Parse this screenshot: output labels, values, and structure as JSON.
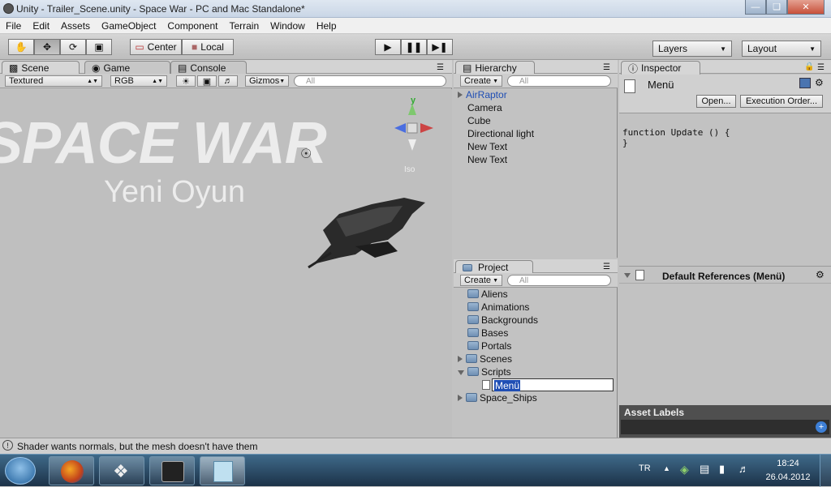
{
  "window": {
    "title": "Unity - Trailer_Scene.unity - Space War - PC and Mac Standalone*"
  },
  "menu": [
    "File",
    "Edit",
    "Assets",
    "GameObject",
    "Component",
    "Terrain",
    "Window",
    "Help"
  ],
  "toolbar": {
    "center": "Center",
    "local": "Local",
    "layers": "Layers",
    "layout": "Layout"
  },
  "scene_panel": {
    "tabs": [
      "Scene",
      "Game",
      "Console"
    ],
    "textured": "Textured",
    "rgb": "RGB",
    "gizmos": "Gizmos",
    "search_placeholder": "All",
    "title_text": "SPACE WAR",
    "subtitle_text": "Yeni Oyun",
    "gizmo_y": "y",
    "gizmo_iso": "Iso"
  },
  "hierarchy": {
    "tab": "Hierarchy",
    "create": "Create",
    "search_placeholder": "All",
    "items": [
      "AirRaptor",
      "Camera",
      "Cube",
      "Directional light",
      "New Text",
      "New Text"
    ]
  },
  "project": {
    "tab": "Project",
    "create": "Create",
    "search_placeholder": "All",
    "folders": [
      "Aliens",
      "Animations",
      "Backgrounds",
      "Bases",
      "Portals",
      "Scenes",
      "Scripts"
    ],
    "script_item": "Menü",
    "last_folder": "Space_Ships"
  },
  "inspector": {
    "tab": "Inspector",
    "object_name": "Menü",
    "open_button": "Open...",
    "execution_order_button": "Execution Order...",
    "code_line1": "function Update () {",
    "code_line2": "}",
    "default_references": "Default References (Menü)",
    "asset_labels": "Asset Labels"
  },
  "status": {
    "message": "Shader wants normals, but the mesh  doesn't have them"
  },
  "taskbar": {
    "language": "TR",
    "time": "18:24",
    "date": "26.04.2012"
  },
  "colors": {
    "selected_text": "#1f4eb4",
    "hierarchy_selected": "#1f4eb4",
    "asset_labels_bg": "#4f4f4f"
  }
}
